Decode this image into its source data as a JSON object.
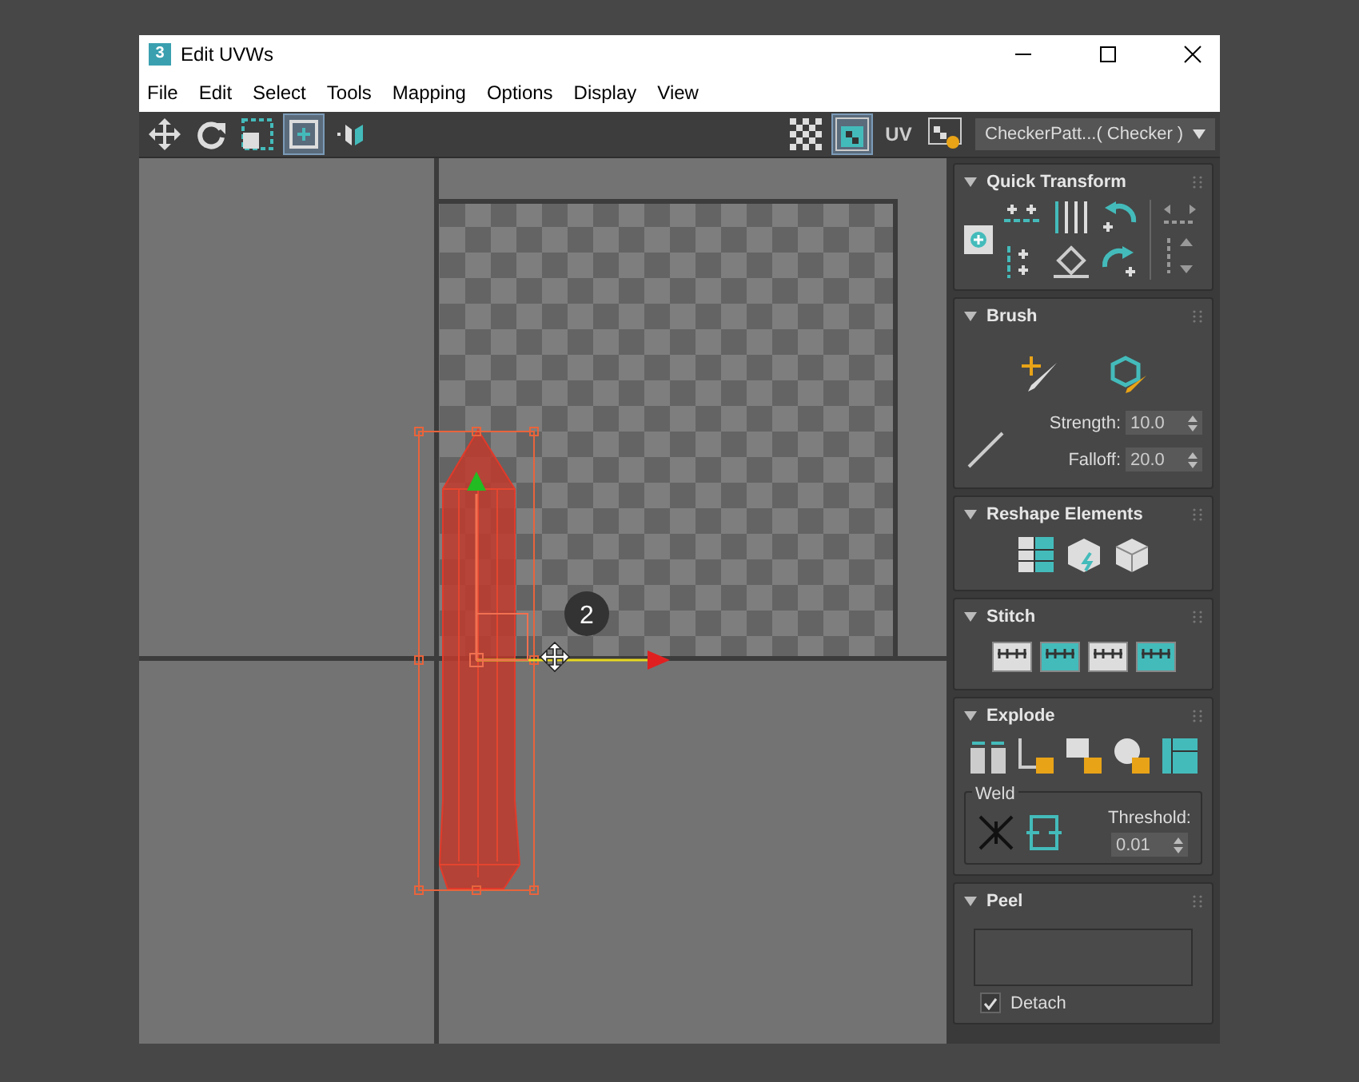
{
  "window": {
    "app_icon": "3",
    "title": "Edit UVWs"
  },
  "menu": [
    "File",
    "Edit",
    "Select",
    "Tools",
    "Mapping",
    "Options",
    "Display",
    "View"
  ],
  "toolbar": {
    "left_tools": [
      {
        "kind": "move",
        "selected": false
      },
      {
        "kind": "rotate",
        "selected": false
      },
      {
        "kind": "scale",
        "selected": false
      },
      {
        "kind": "freeform",
        "selected": true
      },
      {
        "kind": "mirror",
        "selected": false
      }
    ],
    "right_tools": [
      {
        "kind": "checker",
        "selected": false
      },
      {
        "kind": "map",
        "selected": true
      },
      {
        "kind": "uv",
        "label": "UV",
        "selected": false
      },
      {
        "kind": "settings",
        "selected": false
      }
    ],
    "texture_dropdown": "CheckerPatt...( Checker )"
  },
  "viewport": {
    "step_marker": "2"
  },
  "sections": [
    {
      "kind": "quick_transform",
      "title": "Quick Transform",
      "expanded": true
    },
    {
      "kind": "brush",
      "title": "Brush",
      "expanded": true,
      "fields": [
        {
          "label": "Strength:",
          "value": "10.0"
        },
        {
          "label": "Falloff:",
          "value": "20.0"
        }
      ]
    },
    {
      "kind": "reshape",
      "title": "Reshape Elements",
      "expanded": true
    },
    {
      "kind": "stitch",
      "title": "Stitch",
      "expanded": true
    },
    {
      "kind": "explode",
      "title": "Explode",
      "expanded": true,
      "group": "Weld",
      "threshold_label": "Threshold:",
      "threshold_value": "0.01"
    },
    {
      "kind": "peel",
      "title": "Peel",
      "expanded": true,
      "checkbox": {
        "label": "Detach",
        "checked": true
      }
    }
  ]
}
